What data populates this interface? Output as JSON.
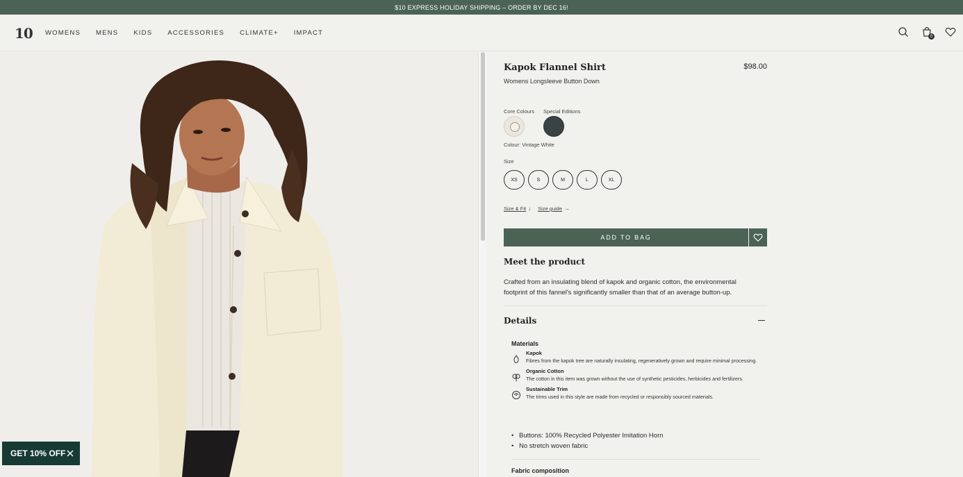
{
  "promo": {
    "text": "$10 EXPRESS HOLIDAY SHIPPING – ORDER BY DEC 16!"
  },
  "header": {
    "logo": "10",
    "nav": [
      "WOMENS",
      "MENS",
      "KIDS",
      "ACCESSORIES",
      "CLIMATE+",
      "IMPACT"
    ],
    "cart_count": "0"
  },
  "product": {
    "title": "Kapok Flannel Shirt",
    "price": "$98.00",
    "subtitle": "Womens Longsleeve Button Down",
    "swatch_groups": [
      "Core Colours",
      "Special Editions"
    ],
    "colour_text": "Colour: Vintage White",
    "size_label": "Size",
    "sizes": [
      "XS",
      "S",
      "M",
      "L",
      "XL"
    ],
    "size_fit_link": "Size & Fit",
    "size_guide_link": "Size guide",
    "add_to_bag": "ADD TO BAG"
  },
  "meet": {
    "title": "Meet the product",
    "text": "Crafted from an insulating blend of kapok and organic cotton, the environmental footprint of this fannel's significantly smaller than that of an average button-up."
  },
  "details": {
    "title": "Details",
    "materials_heading": "Materials",
    "materials": [
      {
        "name": "Kapok",
        "desc": "Fibres from the kapok tree are naturally insulating, regeneratively grown and require minimal processing."
      },
      {
        "name": "Organic Cotton",
        "desc": "The cotton in this item was grown without the use of synthetic pesticides, herbicides and fertilizers."
      },
      {
        "name": "Sustainable Trim",
        "desc": "The trims used in this style are made from recycled or responsibly sourced materials."
      }
    ],
    "bullets": [
      "Buttons: 100% Recycled Polyester Imitation Horn",
      "No stretch woven fabric"
    ],
    "fabric_heading": "Fabric composition"
  },
  "discount": {
    "label": "GET 10% OFF"
  },
  "colors": {
    "brand_green": "#4a6355",
    "swatch_white": "#ece7dc",
    "swatch_dark": "#3b4244"
  }
}
